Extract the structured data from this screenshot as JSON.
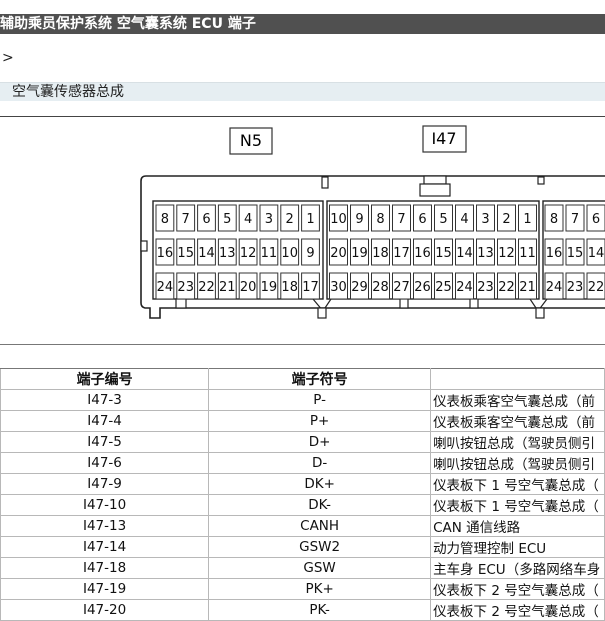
{
  "header": {
    "title": "辅助乘员保护系统  空气囊系统  ECU 端子"
  },
  "breadcrumb": ">",
  "section": {
    "title": "空气囊传感器总成"
  },
  "connectors": {
    "n5_label": "N5",
    "i47_label": "I47",
    "left_block": {
      "row1": [
        "8",
        "7",
        "6",
        "5",
        "4",
        "3",
        "2",
        "1"
      ],
      "row2": [
        "16",
        "15",
        "14",
        "13",
        "12",
        "11",
        "10",
        "9"
      ],
      "row3": [
        "24",
        "23",
        "22",
        "21",
        "20",
        "19",
        "18",
        "17"
      ]
    },
    "mid_block": {
      "row1": [
        "10",
        "9",
        "8",
        "7",
        "6",
        "5",
        "4",
        "3",
        "2",
        "1"
      ],
      "row2": [
        "20",
        "19",
        "18",
        "17",
        "16",
        "15",
        "14",
        "13",
        "12",
        "11"
      ],
      "row3": [
        "30",
        "29",
        "28",
        "27",
        "26",
        "25",
        "24",
        "23",
        "22",
        "21"
      ]
    },
    "right_block": {
      "row1": [
        "8",
        "7",
        "6"
      ],
      "row2": [
        "16",
        "15",
        "14"
      ],
      "row3": [
        "24",
        "23",
        "22"
      ]
    }
  },
  "table": {
    "headers": [
      "端子编号",
      "端子符号",
      ""
    ],
    "rows": [
      {
        "no": "I47-3",
        "sym": "P-",
        "desc": "仪表板乘客空气囊总成（前"
      },
      {
        "no": "I47-4",
        "sym": "P+",
        "desc": "仪表板乘客空气囊总成（前"
      },
      {
        "no": "I47-5",
        "sym": "D+",
        "desc": "喇叭按钮总成（驾驶员侧引"
      },
      {
        "no": "I47-6",
        "sym": "D-",
        "desc": "喇叭按钮总成（驾驶员侧引"
      },
      {
        "no": "I47-9",
        "sym": "DK+",
        "desc": "仪表板下 1 号空气囊总成（"
      },
      {
        "no": "I47-10",
        "sym": "DK-",
        "desc": "仪表板下 1 号空气囊总成（"
      },
      {
        "no": "I47-13",
        "sym": "CANH",
        "desc": "CAN 通信线路"
      },
      {
        "no": "I47-14",
        "sym": "GSW2",
        "desc": "动力管理控制 ECU"
      },
      {
        "no": "I47-18",
        "sym": "GSW",
        "desc": "主车身 ECU（多路网络车身"
      },
      {
        "no": "I47-19",
        "sym": "PK+",
        "desc": "仪表板下 2 号空气囊总成（"
      },
      {
        "no": "I47-20",
        "sym": "PK-",
        "desc": "仪表板下 2 号空气囊总成（"
      }
    ]
  }
}
